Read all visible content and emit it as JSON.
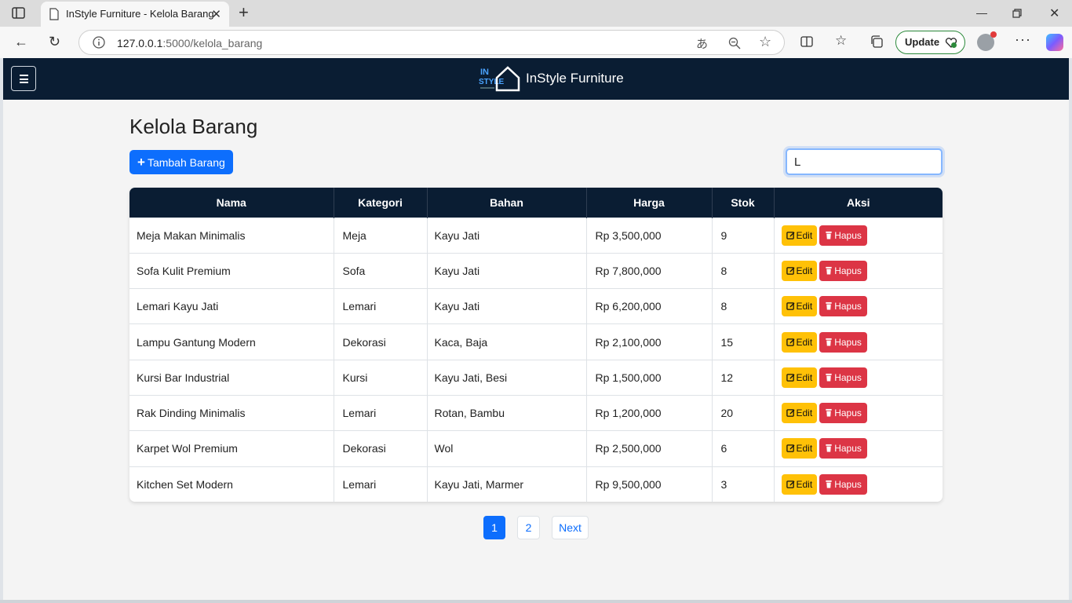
{
  "browser": {
    "tab_title": "InStyle Furniture - Kelola Barang",
    "url_host": "127.0.0.1",
    "url_rest": ":5000/kelola_barang",
    "update_label": "Update"
  },
  "navbar": {
    "brand_name": "InStyle Furniture",
    "logo_line1": "IN",
    "logo_line2": "STYLE"
  },
  "page": {
    "title": "Kelola Barang",
    "add_button_label": "Tambah Barang",
    "search_value": "L"
  },
  "table": {
    "headers": [
      "Nama",
      "Kategori",
      "Bahan",
      "Harga",
      "Stok",
      "Aksi"
    ],
    "edit_label": "Edit",
    "delete_label": "Hapus",
    "rows": [
      {
        "nama": "Meja Makan Minimalis",
        "kategori": "Meja",
        "bahan": "Kayu Jati",
        "harga": "Rp 3,500,000",
        "stok": "9"
      },
      {
        "nama": "Sofa Kulit Premium",
        "kategori": "Sofa",
        "bahan": "Kayu Jati",
        "harga": "Rp 7,800,000",
        "stok": "8"
      },
      {
        "nama": "Lemari Kayu Jati",
        "kategori": "Lemari",
        "bahan": "Kayu Jati",
        "harga": "Rp 6,200,000",
        "stok": "8"
      },
      {
        "nama": "Lampu Gantung Modern",
        "kategori": "Dekorasi",
        "bahan": "Kaca, Baja",
        "harga": "Rp 2,100,000",
        "stok": "15"
      },
      {
        "nama": "Kursi Bar Industrial",
        "kategori": "Kursi",
        "bahan": "Kayu Jati, Besi",
        "harga": "Rp 1,500,000",
        "stok": "12"
      },
      {
        "nama": "Rak Dinding Minimalis",
        "kategori": "Lemari",
        "bahan": "Rotan, Bambu",
        "harga": "Rp 1,200,000",
        "stok": "20"
      },
      {
        "nama": "Karpet Wol Premium",
        "kategori": "Dekorasi",
        "bahan": "Wol",
        "harga": "Rp 2,500,000",
        "stok": "6"
      },
      {
        "nama": "Kitchen Set Modern",
        "kategori": "Lemari",
        "bahan": "Kayu Jati, Marmer",
        "harga": "Rp 9,500,000",
        "stok": "3"
      }
    ]
  },
  "pagination": {
    "page1": "1",
    "page2": "2",
    "next": "Next"
  },
  "colors": {
    "navbar": "#0a1d33",
    "primary": "#0d6efd",
    "warning": "#ffc107",
    "danger": "#dc3545"
  }
}
